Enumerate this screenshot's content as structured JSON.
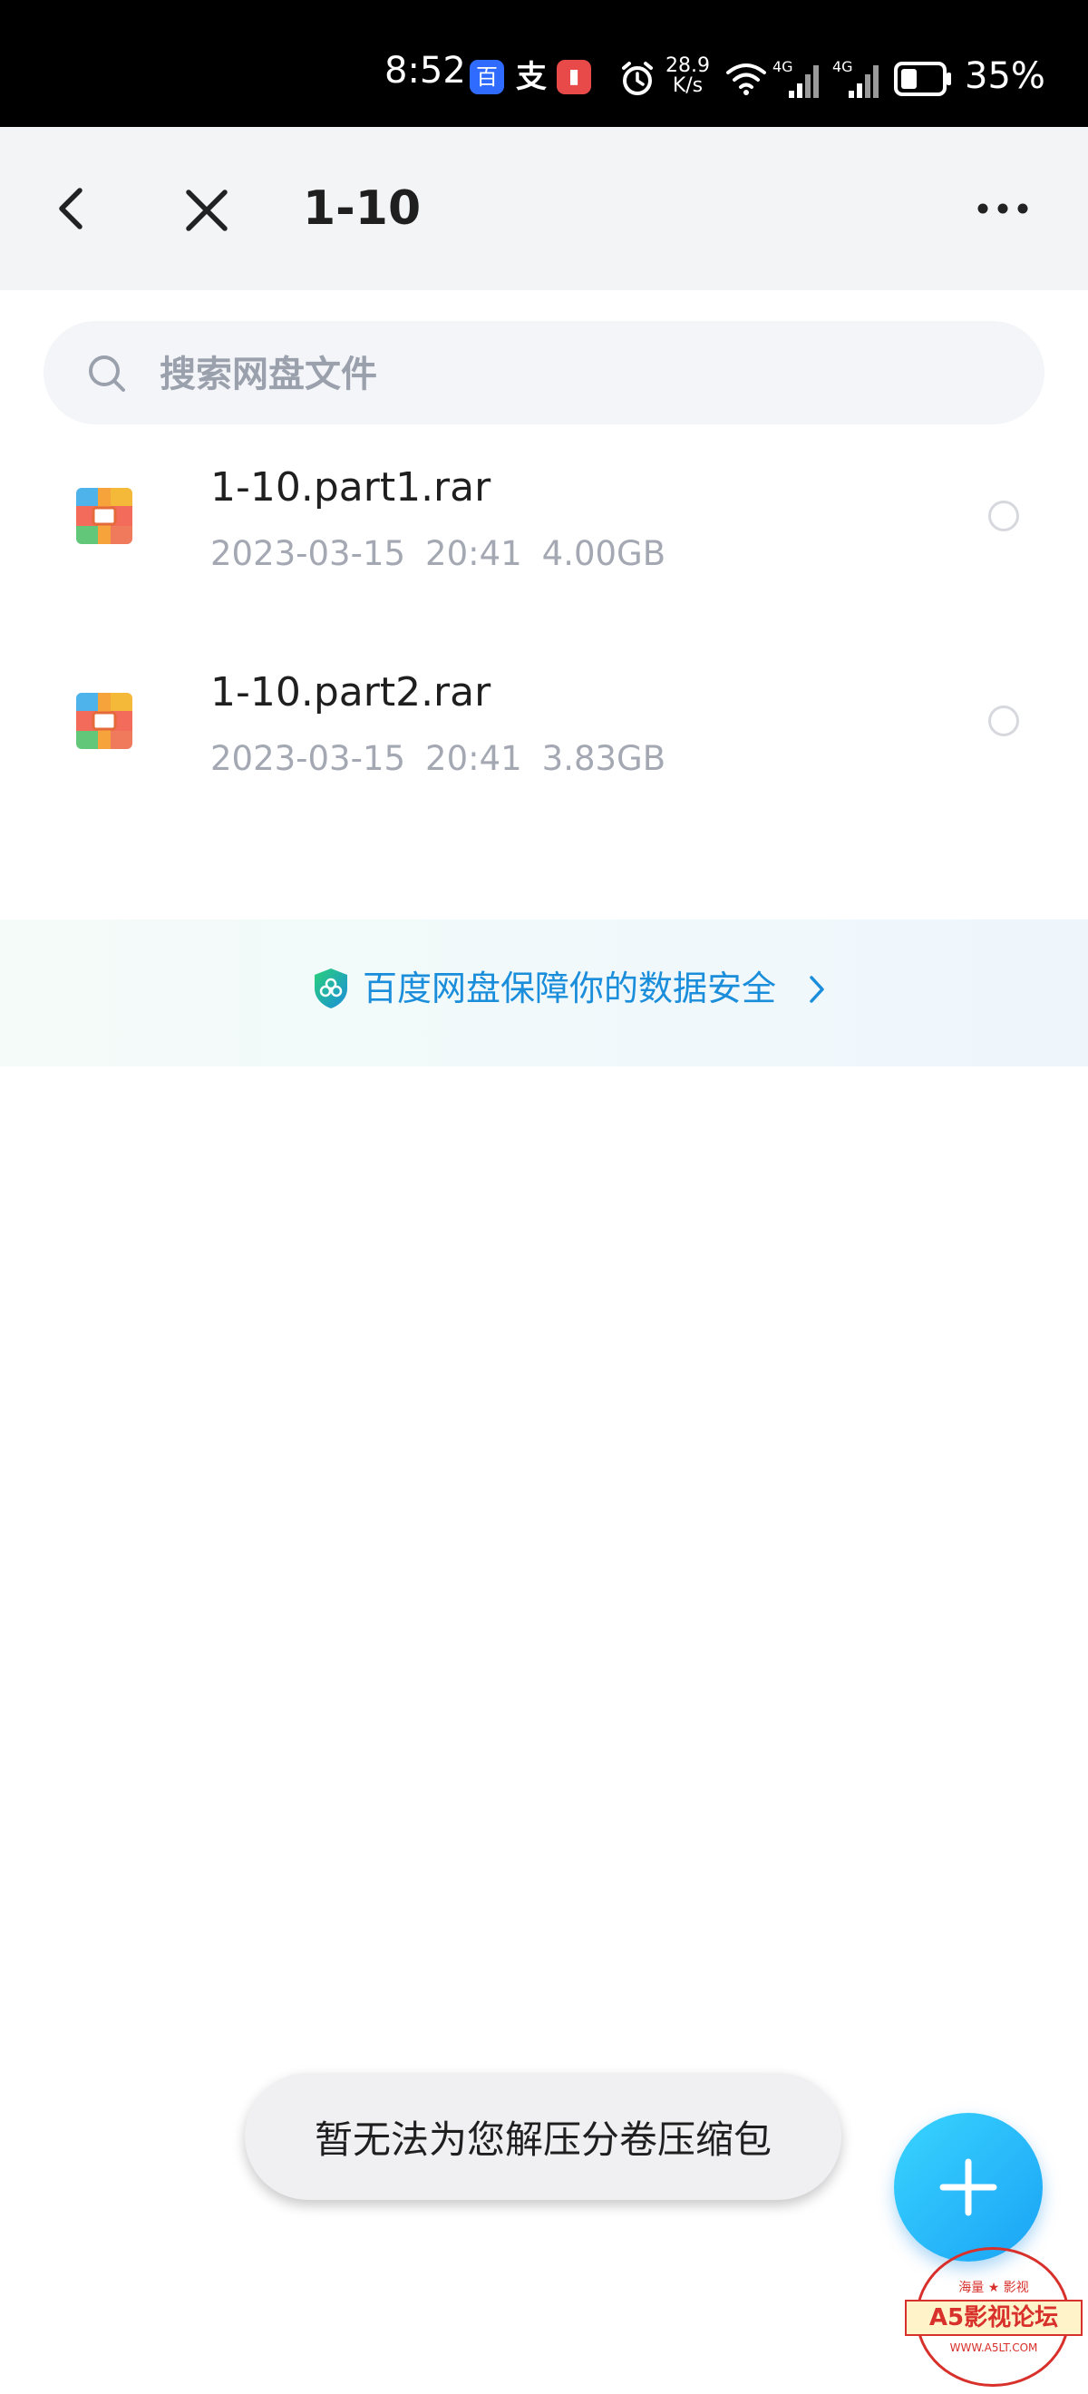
{
  "status_bar": {
    "time": "8:52",
    "app_baidu_glyph": "百",
    "app_alipay_glyph": "支",
    "app_reader_glyph": "▮",
    "net_speed_value": "28.9",
    "net_speed_unit": "K/s",
    "signal_1_label": "4G",
    "signal_2_label": "4G",
    "battery_percent": "35%"
  },
  "header": {
    "title": "1-10"
  },
  "search": {
    "placeholder": "搜索网盘文件"
  },
  "files": [
    {
      "name": "1-10.part1.rar",
      "date": "2023-03-15",
      "time": "20:41",
      "size": "4.00GB"
    },
    {
      "name": "1-10.part2.rar",
      "date": "2023-03-15",
      "time": "20:41",
      "size": "3.83GB"
    }
  ],
  "security_banner": {
    "text": "百度网盘保障你的数据安全"
  },
  "toast": {
    "message": "暂无法为您解压分卷压缩包"
  },
  "watermark": {
    "top_left": "海量",
    "top_right": "影视",
    "main": "A5影视论坛",
    "url": "WWW.A5LT.COM"
  },
  "colors": {
    "accent": "#1aa3f5",
    "banner_text": "#1a8ddb",
    "meta_text": "#a3a8b3",
    "header_bg": "#f3f4f6"
  },
  "icons": {
    "back": "chevron-left-icon",
    "close": "close-icon",
    "more": "more-horizontal-icon",
    "search": "search-icon",
    "file": "archive-file-icon",
    "shield": "shield-icon",
    "chevron": "chevron-right-icon",
    "add": "plus-icon"
  }
}
